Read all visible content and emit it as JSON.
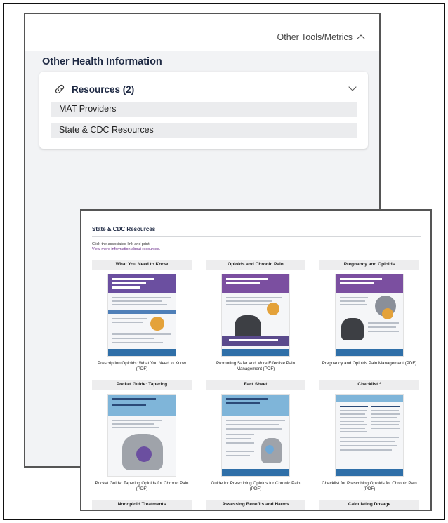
{
  "header": {
    "tools_label": "Other Tools/Metrics"
  },
  "section": {
    "title": "Other Health Information"
  },
  "resources": {
    "title": "Resources (2)",
    "items": [
      "MAT Providers",
      "State & CDC Resources"
    ]
  },
  "modal": {
    "title": "State & CDC Resources",
    "intro_line1": "Click the associated link and print.",
    "intro_link": "View more information about resources.",
    "cards": [
      {
        "title": "What You Need to Know",
        "caption": "Prescription Opioids: What You Need to Know (PDF)"
      },
      {
        "title": "Opioids and Chronic Pain",
        "caption": "Promoting Safer and More Effective Pain Management (PDF)"
      },
      {
        "title": "Pregnancy and Opioids",
        "caption": "Pregnancy and Opioids Pain Management (PDF)"
      },
      {
        "title": "Pocket Guide: Tapering",
        "caption": "Pocket Guide: Tapering Opioids for Chronic Pain (PDF)"
      },
      {
        "title": "Fact Sheet",
        "caption": "Guide for Prescribing Opioids for Chronic Pain (PDF)"
      },
      {
        "title": "Checklist *",
        "caption": "Checklist for Prescribing Opioids for Chronic Pain (PDF)"
      },
      {
        "title": "Nonopioid Treatments"
      },
      {
        "title": "Assessing Benefits and Harms"
      },
      {
        "title": "Calculating Dosage"
      }
    ]
  },
  "colors": {
    "accent_purple": "#7b4fa0",
    "accent_blue": "#2f6fa8",
    "text_dark": "#1f2a44"
  }
}
